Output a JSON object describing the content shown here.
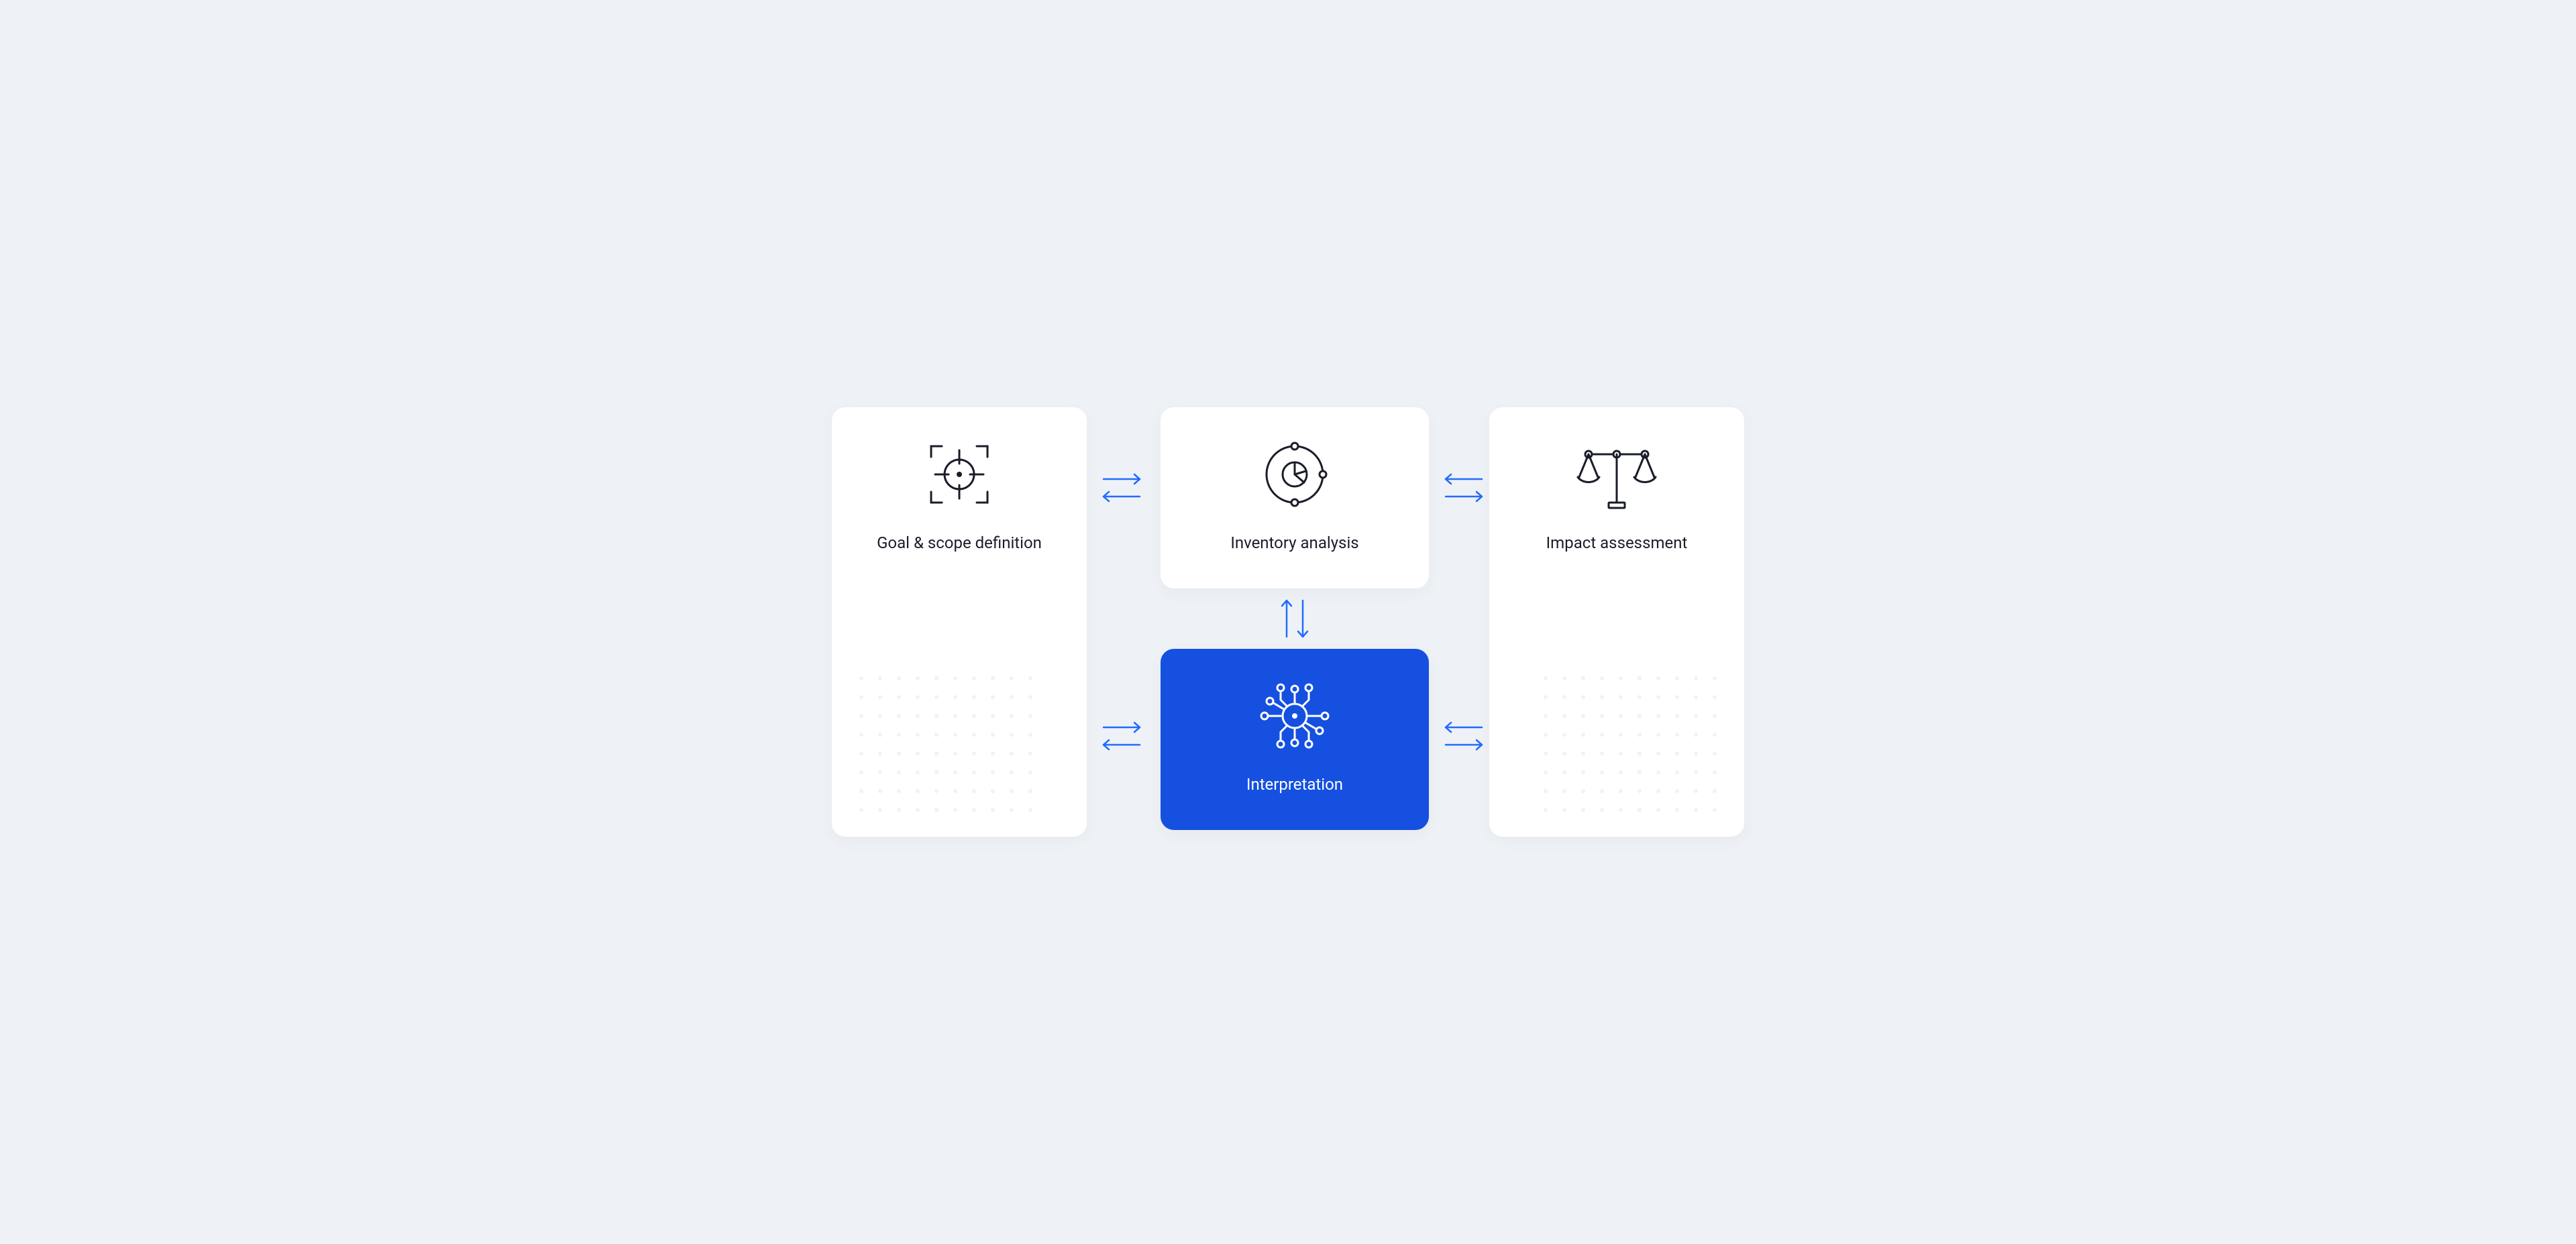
{
  "cards": {
    "goal": {
      "label": "Goal & scope definition"
    },
    "inv": {
      "label": "Inventory analysis"
    },
    "impact": {
      "label": "Impact assessment"
    },
    "interp": {
      "label": "Interpretation"
    }
  },
  "colors": {
    "accent": "#1550e0",
    "arrow": "#236bff",
    "ink": "#1a1d29"
  }
}
